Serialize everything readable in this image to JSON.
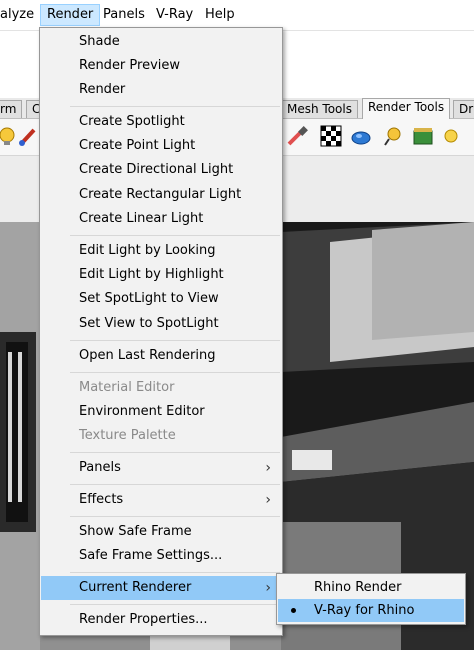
{
  "menubar": {
    "items": [
      {
        "label": "alyze",
        "active": false
      },
      {
        "label": "Render",
        "active": true
      },
      {
        "label": "Panels",
        "active": false
      },
      {
        "label": "V-Ray",
        "active": false
      },
      {
        "label": "Help",
        "active": false
      }
    ]
  },
  "tabs": [
    {
      "label": "rm"
    },
    {
      "label": "C"
    },
    {
      "label": "Mesh Tools"
    },
    {
      "label": "Render Tools",
      "active": true
    },
    {
      "label": "Dr"
    }
  ],
  "toolbar_icons": [
    "light-bulb-icon",
    "paint-brush-icon",
    "eyedropper-icon",
    "checker-texture-icon",
    "sphere-icon",
    "spotlight-icon",
    "window-icon",
    "sun-icon"
  ],
  "render_menu": {
    "groups": [
      [
        {
          "label": "Shade"
        },
        {
          "label": "Render Preview"
        },
        {
          "label": "Render"
        }
      ],
      [
        {
          "label": "Create Spotlight"
        },
        {
          "label": "Create Point Light"
        },
        {
          "label": "Create Directional Light"
        },
        {
          "label": "Create Rectangular Light"
        },
        {
          "label": "Create Linear Light"
        }
      ],
      [
        {
          "label": "Edit Light by Looking"
        },
        {
          "label": "Edit Light by Highlight"
        },
        {
          "label": "Set SpotLight to View"
        },
        {
          "label": "Set View to SpotLight"
        }
      ],
      [
        {
          "label": "Open Last Rendering"
        }
      ],
      [
        {
          "label": "Material Editor",
          "disabled": true
        },
        {
          "label": "Environment Editor"
        },
        {
          "label": "Texture Palette",
          "disabled": true
        }
      ],
      [
        {
          "label": "Panels",
          "submenu": true
        }
      ],
      [
        {
          "label": "Effects",
          "submenu": true
        }
      ],
      [
        {
          "label": "Show Safe Frame"
        },
        {
          "label": "Safe Frame Settings..."
        }
      ],
      [
        {
          "label": "Current Renderer",
          "submenu": true,
          "highlighted": true
        }
      ],
      [
        {
          "label": "Render Properties..."
        }
      ]
    ],
    "submenu_arrow": "›"
  },
  "renderer_submenu": {
    "items": [
      {
        "label": "Rhino Render",
        "selected": false
      },
      {
        "label": "V-Ray for Rhino",
        "selected": true,
        "highlighted": true
      }
    ]
  },
  "colors": {
    "highlight": "#91c9f7",
    "menu_bg": "#f2f2f2",
    "active_menubar": "#cce8ff",
    "disabled_text": "#8a8a8a"
  }
}
